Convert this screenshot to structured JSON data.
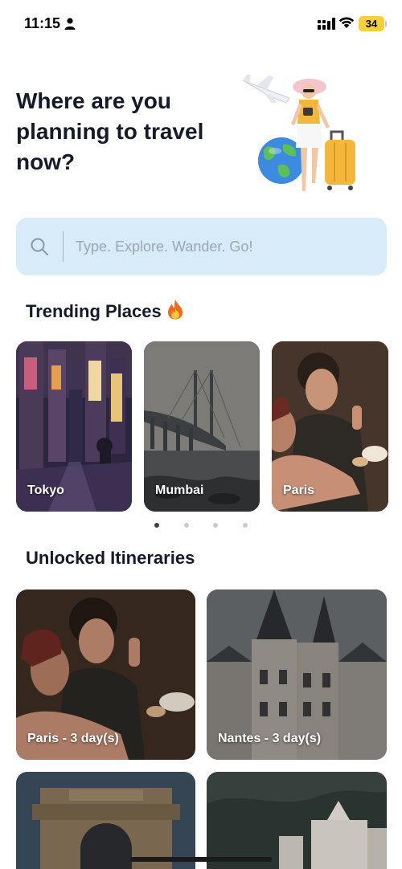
{
  "status": {
    "time": "11:15",
    "battery": "34"
  },
  "headline": "Where are you planning to travel now?",
  "search": {
    "placeholder": "Type. Explore. Wander. Go!"
  },
  "trending": {
    "title": "Trending Places",
    "places": [
      {
        "label": "Tokyo"
      },
      {
        "label": "Mumbai"
      },
      {
        "label": "Paris"
      }
    ],
    "page_count": 4,
    "active_page": 1
  },
  "itineraries": {
    "title": "Unlocked Itineraries",
    "items": [
      {
        "label": "Paris - 3 day(s)"
      },
      {
        "label": "Nantes - 3 day(s)"
      },
      {
        "label": ""
      },
      {
        "label": ""
      }
    ]
  },
  "colors": {
    "search_bg": "#d7ebf8",
    "battery": "#f6cf3a",
    "text": "#141a2a"
  }
}
